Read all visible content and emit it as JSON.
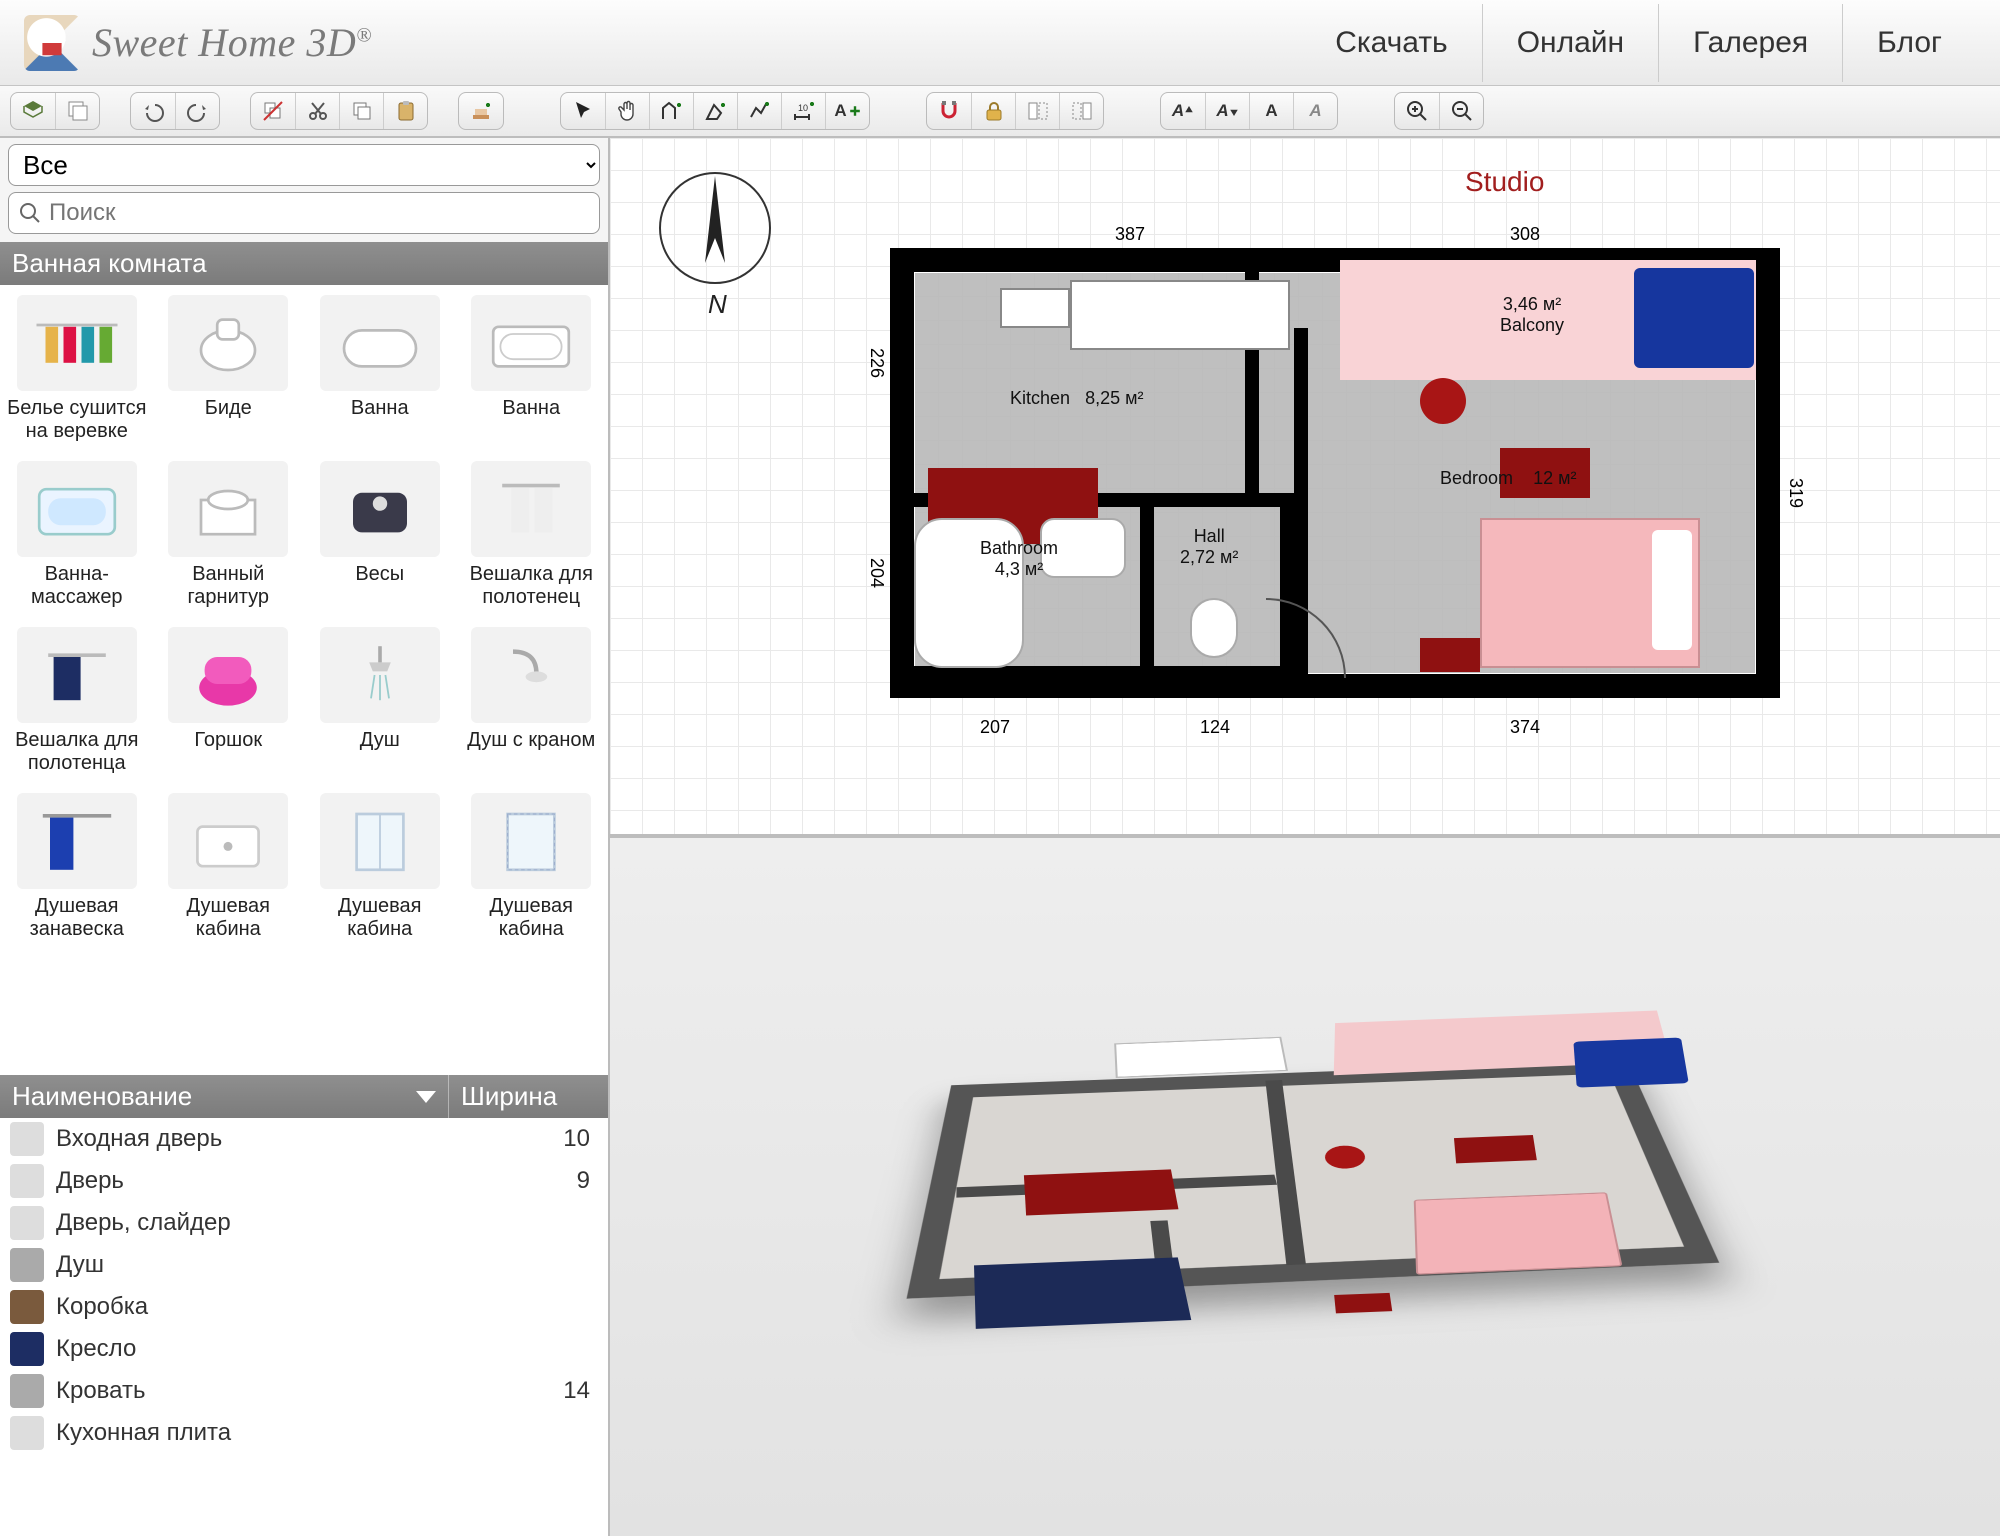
{
  "brand": "Sweet Home 3D",
  "nav": {
    "download": "Скачать",
    "online": "Онлайн",
    "gallery": "Галерея",
    "blog": "Блог"
  },
  "toolbar_names": [
    "mode-2d",
    "mode-3d",
    "undo",
    "redo",
    "cut-multi",
    "cut",
    "copy",
    "paste",
    "add-furniture",
    "select",
    "pan",
    "create-walls",
    "create-room",
    "create-polyline",
    "create-dimension",
    "create-text",
    "snap",
    "lock",
    "align-left",
    "align-right",
    "text-bold-plus",
    "text-bold-minus",
    "text-bold",
    "text-italic",
    "zoom-in",
    "zoom-out"
  ],
  "category_select": "Все",
  "search_placeholder": "Поиск",
  "section_title": "Ванная комната",
  "catalog": [
    {
      "label": "Белье сушится на веревке",
      "icon": "clothesline"
    },
    {
      "label": "Биде",
      "icon": "bidet"
    },
    {
      "label": "Ванна",
      "icon": "bathtub1"
    },
    {
      "label": "Ванна",
      "icon": "bathtub2"
    },
    {
      "label": "Ванна-массажер",
      "icon": "jacuzzi"
    },
    {
      "label": "Ванный гарнитур",
      "icon": "vanity"
    },
    {
      "label": "Весы",
      "icon": "scale"
    },
    {
      "label": "Вешалка для полотенец",
      "icon": "towel-rack"
    },
    {
      "label": "Вешалка для полотенца",
      "icon": "towel-rail"
    },
    {
      "label": "Горшок",
      "icon": "potty"
    },
    {
      "label": "Душ",
      "icon": "shower1"
    },
    {
      "label": "Душ с краном",
      "icon": "shower-head"
    },
    {
      "label": "Душевая занавеска",
      "icon": "curtain"
    },
    {
      "label": "Душевая кабина",
      "icon": "shower-tray"
    },
    {
      "label": "Душевая кабина",
      "icon": "shower-box1"
    },
    {
      "label": "Душевая кабина",
      "icon": "shower-box2"
    }
  ],
  "furniture_header": {
    "name": "Наименование",
    "width": "Ширина"
  },
  "furniture": [
    {
      "name": "Входная дверь",
      "width": "10",
      "ico": "lgrey"
    },
    {
      "name": "Дверь",
      "width": "9",
      "ico": "lgrey"
    },
    {
      "name": "Дверь, слайдер",
      "width": "",
      "ico": "lgrey"
    },
    {
      "name": "Душ",
      "width": "",
      "ico": "grey"
    },
    {
      "name": "Коробка",
      "width": "",
      "ico": "brown"
    },
    {
      "name": "Кресло",
      "width": "",
      "ico": "navy"
    },
    {
      "name": "Кровать",
      "width": "14",
      "ico": "grey"
    },
    {
      "name": "Кухонная плита",
      "width": "",
      "ico": "lgrey"
    }
  ],
  "plan": {
    "title": "Studio",
    "rooms": {
      "kitchen": {
        "name": "Kitchen",
        "area": "8,25 м²"
      },
      "balcony": {
        "name": "Balcony",
        "area": "3,46 м²"
      },
      "bedroom": {
        "name": "Bedroom",
        "area": "12 м²"
      },
      "bathroom": {
        "name": "Bathroom",
        "area": "4,3 м²"
      },
      "hall": {
        "name": "Hall",
        "area": "2,72 м²"
      }
    },
    "dims": {
      "top1": "387",
      "top2": "308",
      "left1": "226",
      "left2": "204",
      "right": "319",
      "bot1": "207",
      "bot2": "124",
      "bot3": "374"
    }
  }
}
